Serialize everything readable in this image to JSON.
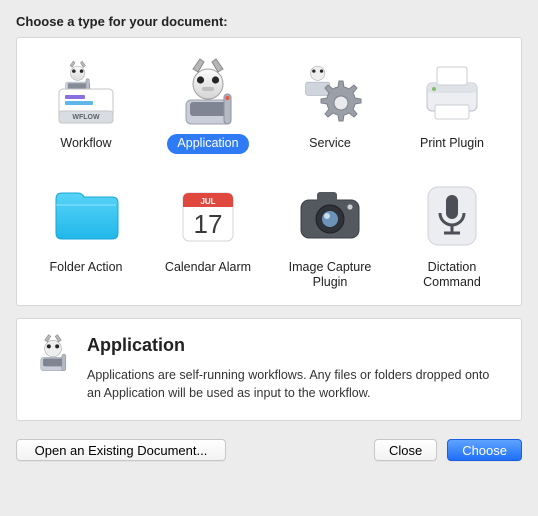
{
  "heading": "Choose a type for your document:",
  "types": [
    {
      "id": "workflow",
      "label": "Workflow",
      "selected": false
    },
    {
      "id": "application",
      "label": "Application",
      "selected": true
    },
    {
      "id": "service",
      "label": "Service",
      "selected": false
    },
    {
      "id": "print-plugin",
      "label": "Print Plugin",
      "selected": false
    },
    {
      "id": "folder-action",
      "label": "Folder Action",
      "selected": false
    },
    {
      "id": "calendar-alarm",
      "label": "Calendar Alarm",
      "selected": false
    },
    {
      "id": "image-capture-plugin",
      "label": "Image Capture Plugin",
      "selected": false
    },
    {
      "id": "dictation-command",
      "label": "Dictation Command",
      "selected": false
    }
  ],
  "detail": {
    "title": "Application",
    "description": "Applications are self-running workflows. Any files or folders dropped onto an Application will be used as input to the workflow."
  },
  "calendar": {
    "month": "JUL",
    "day": "17"
  },
  "workflow_badge": "WFLOW",
  "buttons": {
    "open": "Open an Existing Document...",
    "close": "Close",
    "choose": "Choose"
  }
}
